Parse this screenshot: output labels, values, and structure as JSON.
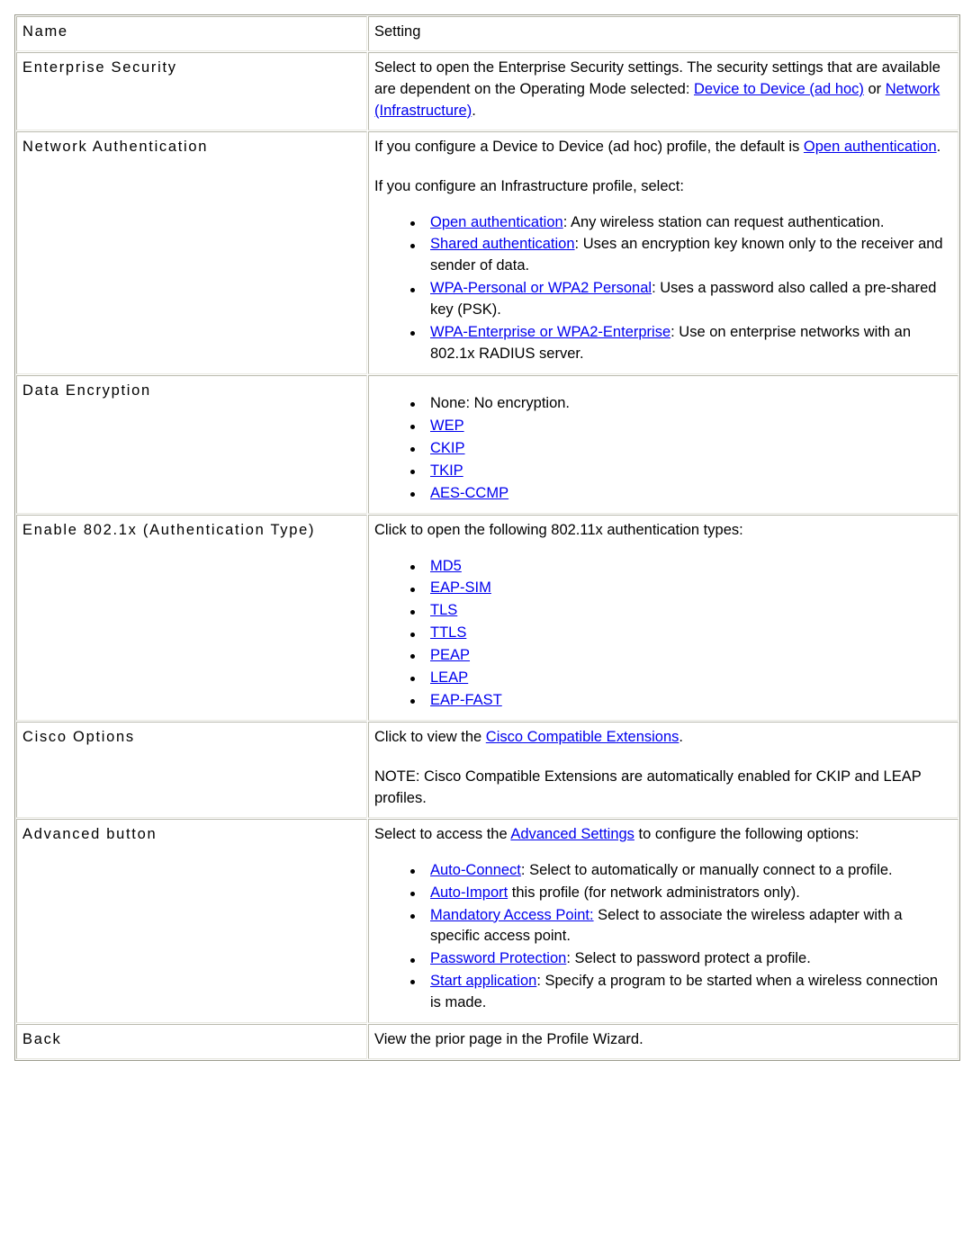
{
  "table": {
    "headers": {
      "name": "Name",
      "setting": "Setting"
    },
    "rows": [
      {
        "name": "Enterprise Security",
        "paragraphs": [
          {
            "parts": [
              {
                "type": "text",
                "text": "Select to open the Enterprise Security settings. The security settings that are available are dependent on the Operating Mode selected: "
              },
              {
                "type": "link",
                "text": "Device to Device (ad hoc)"
              },
              {
                "type": "text",
                "text": " or "
              },
              {
                "type": "link",
                "text": "Network (Infrastructure)"
              },
              {
                "type": "text",
                "text": "."
              }
            ]
          }
        ],
        "bullets": []
      },
      {
        "name": "Network Authentication",
        "paragraphs": [
          {
            "parts": [
              {
                "type": "text",
                "text": "If you configure a Device to Device (ad hoc) profile, the default is "
              },
              {
                "type": "link",
                "text": "Open authentication"
              },
              {
                "type": "text",
                "text": "."
              }
            ]
          },
          {
            "parts": [
              {
                "type": "text",
                "text": "If you configure an Infrastructure profile, select:"
              }
            ]
          }
        ],
        "bullets": [
          {
            "parts": [
              {
                "type": "link",
                "text": "Open authentication"
              },
              {
                "type": "text",
                "text": ": Any wireless station can request authentication."
              }
            ]
          },
          {
            "parts": [
              {
                "type": "link",
                "text": "Shared authentication"
              },
              {
                "type": "text",
                "text": ": Uses an encryption key known only to the receiver and sender of data."
              }
            ]
          },
          {
            "parts": [
              {
                "type": "link",
                "text": "WPA-Personal or WPA2 Personal"
              },
              {
                "type": "text",
                "text": ": Uses a password also called a pre-shared key (PSK)."
              }
            ]
          },
          {
            "parts": [
              {
                "type": "link",
                "text": "WPA-Enterprise or WPA2-Enterprise"
              },
              {
                "type": "text",
                "text": ": Use on enterprise networks with an 802.1x RADIUS server."
              }
            ]
          }
        ]
      },
      {
        "name": "Data Encryption",
        "paragraphs": [],
        "bullets": [
          {
            "parts": [
              {
                "type": "text",
                "text": "None: No encryption."
              }
            ]
          },
          {
            "parts": [
              {
                "type": "link",
                "text": "WEP"
              }
            ]
          },
          {
            "parts": [
              {
                "type": "link",
                "text": "CKIP"
              }
            ]
          },
          {
            "parts": [
              {
                "type": "link",
                "text": "TKIP"
              }
            ]
          },
          {
            "parts": [
              {
                "type": "link",
                "text": "AES-CCMP"
              }
            ]
          }
        ]
      },
      {
        "name": "Enable 802.1x (Authentication Type)",
        "paragraphs": [
          {
            "parts": [
              {
                "type": "text",
                "text": "Click to open the following 802.11x authentication types:"
              }
            ]
          }
        ],
        "bullets": [
          {
            "parts": [
              {
                "type": "link",
                "text": "MD5"
              }
            ]
          },
          {
            "parts": [
              {
                "type": "link",
                "text": "EAP-SIM"
              }
            ]
          },
          {
            "parts": [
              {
                "type": "link",
                "text": "TLS"
              }
            ]
          },
          {
            "parts": [
              {
                "type": "link",
                "text": "TTLS"
              }
            ]
          },
          {
            "parts": [
              {
                "type": "link",
                "text": "PEAP"
              }
            ]
          },
          {
            "parts": [
              {
                "type": "link",
                "text": "LEAP"
              }
            ]
          },
          {
            "parts": [
              {
                "type": "link",
                "text": "EAP-FAST"
              }
            ]
          }
        ]
      },
      {
        "name": "Cisco Options",
        "paragraphs": [
          {
            "parts": [
              {
                "type": "text",
                "text": "Click to view the "
              },
              {
                "type": "link",
                "text": "Cisco Compatible Extensions"
              },
              {
                "type": "text",
                "text": "."
              }
            ]
          },
          {
            "parts": [
              {
                "type": "text",
                "text": "NOTE: Cisco Compatible Extensions are automatically enabled for CKIP and LEAP profiles."
              }
            ]
          }
        ],
        "bullets": []
      },
      {
        "name": "Advanced button",
        "paragraphs": [
          {
            "parts": [
              {
                "type": "text",
                "text": "Select to access the "
              },
              {
                "type": "link",
                "text": "Advanced Settings"
              },
              {
                "type": "text",
                "text": " to configure the following options:"
              }
            ]
          }
        ],
        "bullets": [
          {
            "parts": [
              {
                "type": "link",
                "text": "Auto-Connect"
              },
              {
                "type": "text",
                "text": ": Select to automatically or manually connect to a profile."
              }
            ]
          },
          {
            "parts": [
              {
                "type": "link",
                "text": "Auto-Import"
              },
              {
                "type": "text",
                "text": " this profile (for network administrators only)."
              }
            ]
          },
          {
            "parts": [
              {
                "type": "link",
                "text": "Mandatory Access Point:"
              },
              {
                "type": "text",
                "text": " Select to associate the wireless adapter with a specific access point."
              }
            ]
          },
          {
            "parts": [
              {
                "type": "link",
                "text": "Password Protection"
              },
              {
                "type": "text",
                "text": ": Select to password protect a profile."
              }
            ]
          },
          {
            "parts": [
              {
                "type": "link",
                "text": "Start application"
              },
              {
                "type": "text",
                "text": ": Specify a program to be started when a wireless connection is made."
              }
            ]
          }
        ]
      },
      {
        "name": "Back",
        "paragraphs": [
          {
            "parts": [
              {
                "type": "text",
                "text": "View the prior page in the Profile Wizard."
              }
            ]
          }
        ],
        "bullets": []
      }
    ]
  },
  "colors": {
    "link": "#0000ee",
    "text": "#000000",
    "border": "#b9b9ad"
  }
}
